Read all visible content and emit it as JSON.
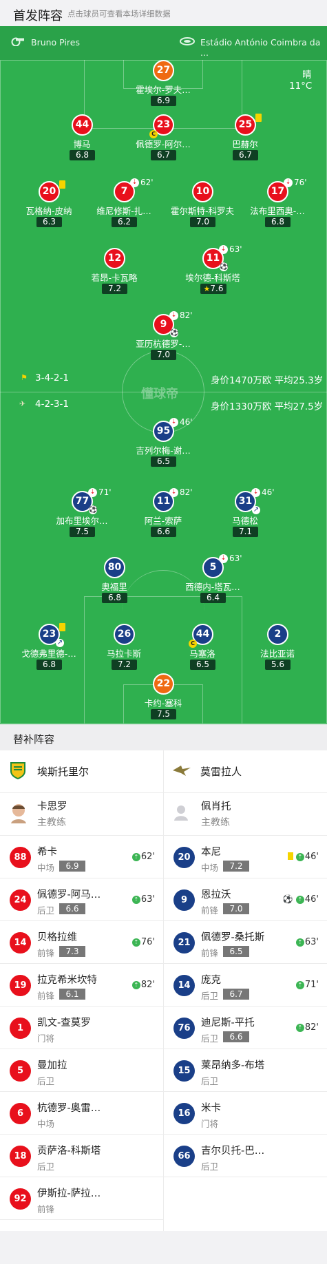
{
  "header": {
    "title": "首发阵容",
    "subtitle": "点击球员可查看本场详细数据"
  },
  "match": {
    "referee": "Bruno Pires",
    "stadium": "Estádio António Coimbra da ...",
    "weather": "晴",
    "temperature": "11°C",
    "watermark": "懂球帝"
  },
  "home": {
    "formation": "3-4-2-1",
    "summary": "身价1470万欧 平均25.3岁"
  },
  "away": {
    "formation": "4-2-3-1",
    "summary": "身价1330万欧 平均27.5岁"
  },
  "home_lineup": [
    {
      "num": "27",
      "name": "霍埃尔-罗夫…",
      "rating": "6.9",
      "gk": true
    },
    {
      "num": "44",
      "name": "博马",
      "rating": "6.8"
    },
    {
      "num": "23",
      "name": "佩德罗-阿尔…",
      "rating": "6.7",
      "captain": "C"
    },
    {
      "num": "25",
      "name": "巴赫尔",
      "rating": "6.7",
      "yellow": true
    },
    {
      "num": "20",
      "name": "瓦格纳-皮纳",
      "rating": "6.3",
      "yellow": true
    },
    {
      "num": "7",
      "name": "维尼修斯-扎…",
      "rating": "6.2",
      "sub": "62'"
    },
    {
      "num": "10",
      "name": "霍尔斯特-科罗夫",
      "rating": "7.0"
    },
    {
      "num": "17",
      "name": "法布里西奥-…",
      "rating": "6.8",
      "sub": "76'"
    },
    {
      "num": "12",
      "name": "若昂-卡瓦略",
      "rating": "7.2"
    },
    {
      "num": "11",
      "name": "埃尔德-科斯塔",
      "rating": "7.6",
      "sub": "63'",
      "goal": true,
      "star": true
    },
    {
      "num": "9",
      "name": "亚历杭德罗-…",
      "rating": "7.0",
      "sub": "82'",
      "goal": true
    }
  ],
  "away_lineup": [
    {
      "num": "95",
      "name": "吉列尔梅-谢…",
      "rating": "6.5",
      "sub": "46'"
    },
    {
      "num": "77",
      "name": "加布里埃尔…",
      "rating": "7.5",
      "sub": "71'",
      "goal": true
    },
    {
      "num": "11",
      "name": "阿兰-索萨",
      "rating": "6.6",
      "sub": "82'"
    },
    {
      "num": "31",
      "name": "马德松",
      "rating": "7.1",
      "sub": "46'",
      "assist": true
    },
    {
      "num": "80",
      "name": "奥福里",
      "rating": "6.8"
    },
    {
      "num": "5",
      "name": "西德内-塔瓦…",
      "rating": "6.4",
      "sub": "63'"
    },
    {
      "num": "23",
      "name": "戈德弗里德-…",
      "rating": "6.8",
      "yellow": true,
      "assist": true
    },
    {
      "num": "26",
      "name": "马拉卡斯",
      "rating": "7.2"
    },
    {
      "num": "44",
      "name": "马塞洛",
      "rating": "6.5",
      "captain": "C"
    },
    {
      "num": "2",
      "name": "法比亚诺",
      "rating": "5.6"
    },
    {
      "num": "22",
      "name": "卡约-塞科",
      "rating": "7.5",
      "gk": true
    }
  ],
  "bench": {
    "title": "替补阵容",
    "home_team": "埃斯托里尔",
    "away_team": "莫雷拉人",
    "home_coach": {
      "name": "卡思罗",
      "role": "主教练"
    },
    "away_coach": {
      "name": "佩肖托",
      "role": "主教练"
    },
    "home": [
      {
        "num": "88",
        "name": "希卡",
        "pos": "中场",
        "rating": "6.9",
        "sub_in": "62'"
      },
      {
        "num": "24",
        "name": "佩德罗-阿马…",
        "pos": "后卫",
        "rating": "6.6",
        "sub_in": "63'"
      },
      {
        "num": "14",
        "name": "贝格拉维",
        "pos": "前锋",
        "rating": "7.3",
        "sub_in": "76'"
      },
      {
        "num": "19",
        "name": "拉克希米坎特",
        "pos": "前锋",
        "rating": "6.1",
        "sub_in": "82'"
      },
      {
        "num": "1",
        "name": "凯文-查莫罗",
        "pos": "门将"
      },
      {
        "num": "5",
        "name": "曼加拉",
        "pos": "后卫"
      },
      {
        "num": "6",
        "name": "杭德罗-奥雷…",
        "pos": "中场"
      },
      {
        "num": "18",
        "name": "贡萨洛-科斯塔",
        "pos": "后卫"
      },
      {
        "num": "92",
        "name": "伊斯拉-萨拉…",
        "pos": "前锋"
      }
    ],
    "away": [
      {
        "num": "20",
        "name": "本尼",
        "pos": "中场",
        "rating": "7.2",
        "sub_in": "46'",
        "yellow": true
      },
      {
        "num": "9",
        "name": "恩拉沃",
        "pos": "前锋",
        "rating": "7.0",
        "sub_in": "46'",
        "goal": true
      },
      {
        "num": "21",
        "name": "佩德罗-桑托斯",
        "pos": "前锋",
        "rating": "6.5",
        "sub_in": "63'"
      },
      {
        "num": "14",
        "name": "庞克",
        "pos": "后卫",
        "rating": "6.7",
        "sub_in": "71'"
      },
      {
        "num": "76",
        "name": "迪尼斯-平托",
        "pos": "后卫",
        "rating": "6.6",
        "sub_in": "82'"
      },
      {
        "num": "15",
        "name": "莱昂纳多-布塔",
        "pos": "后卫"
      },
      {
        "num": "16",
        "name": "米卡",
        "pos": "门将"
      },
      {
        "num": "66",
        "name": "吉尔贝托-巴…",
        "pos": "后卫"
      }
    ]
  }
}
